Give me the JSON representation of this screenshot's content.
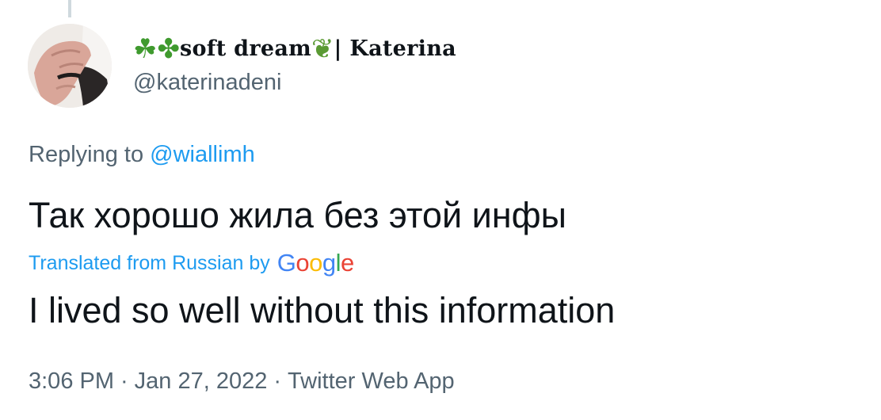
{
  "author": {
    "display_name_prefix_emoji": "☘✤",
    "display_name_text": "soft dream",
    "display_name_suffix_emoji": "❦",
    "display_name_tail": "| Katerina",
    "handle": "@katerinadeni"
  },
  "reply": {
    "label": "Replying to",
    "mention": "@wiallimh"
  },
  "tweet": {
    "text": "Так хорошо жила без этой инфы",
    "translated_label": "Translated from Russian by",
    "translator_logo": {
      "letters": [
        "G",
        "o",
        "o",
        "g",
        "l",
        "e"
      ]
    },
    "translation": "I lived so well without this information"
  },
  "meta": {
    "time": "3:06 PM",
    "separator": "·",
    "date": "Jan 27, 2022",
    "source": "Twitter Web App"
  },
  "colors": {
    "link": "#1d9bf0",
    "secondary_text": "#536471",
    "primary_text": "#0f1419"
  }
}
